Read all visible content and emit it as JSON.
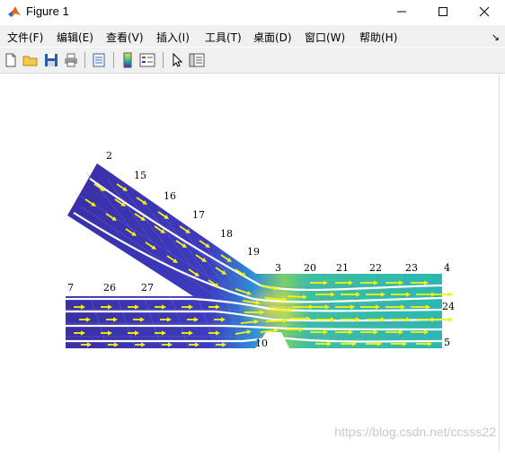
{
  "window": {
    "title": "Figure 1"
  },
  "menu": [
    {
      "label": "文件(F)"
    },
    {
      "label": "编辑(E)"
    },
    {
      "label": "查看(V)"
    },
    {
      "label": "插入(I)"
    },
    {
      "label": "工具(T)"
    },
    {
      "label": "桌面(D)"
    },
    {
      "label": "窗口(W)"
    },
    {
      "label": "帮助(H)"
    }
  ],
  "toolbar_icons": [
    "new-figure-icon",
    "open-file-icon",
    "save-icon",
    "print-icon",
    "print-preview-icon",
    "colorbar-icon",
    "legend-icon",
    "pointer-icon",
    "property-inspector-icon"
  ],
  "figure": {
    "node_labels": [
      "2",
      "15",
      "16",
      "17",
      "18",
      "19",
      "3",
      "20",
      "21",
      "22",
      "23",
      "4",
      "24",
      "5",
      "7",
      "26",
      "27",
      "10"
    ]
  },
  "watermark": "https://blog.csdn.net/ccsss22"
}
